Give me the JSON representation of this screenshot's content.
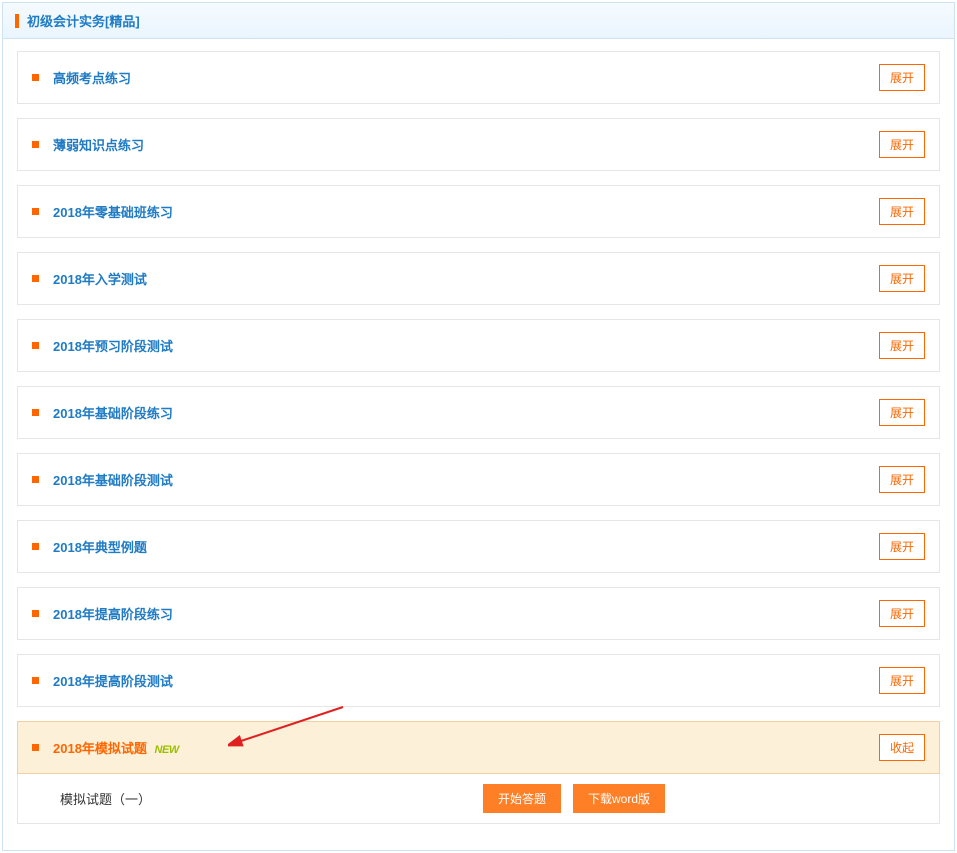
{
  "header": {
    "title": "初级会计实务[精品]"
  },
  "rows": [
    {
      "title": "高频考点练习",
      "action": "展开"
    },
    {
      "title": "薄弱知识点练习",
      "action": "展开"
    },
    {
      "title": "2018年零基础班练习",
      "action": "展开"
    },
    {
      "title": "2018年入学测试",
      "action": "展开"
    },
    {
      "title": "2018年预习阶段测试",
      "action": "展开"
    },
    {
      "title": "2018年基础阶段练习",
      "action": "展开"
    },
    {
      "title": "2018年基础阶段测试",
      "action": "展开"
    },
    {
      "title": "2018年典型例题",
      "action": "展开"
    },
    {
      "title": "2018年提高阶段练习",
      "action": "展开"
    },
    {
      "title": "2018年提高阶段测试",
      "action": "展开"
    }
  ],
  "expanded": {
    "title": "2018年模拟试题",
    "badge": "NEW",
    "action": "收起",
    "sub": {
      "title": "模拟试题（一）",
      "start": "开始答题",
      "download": "下载word版"
    }
  }
}
